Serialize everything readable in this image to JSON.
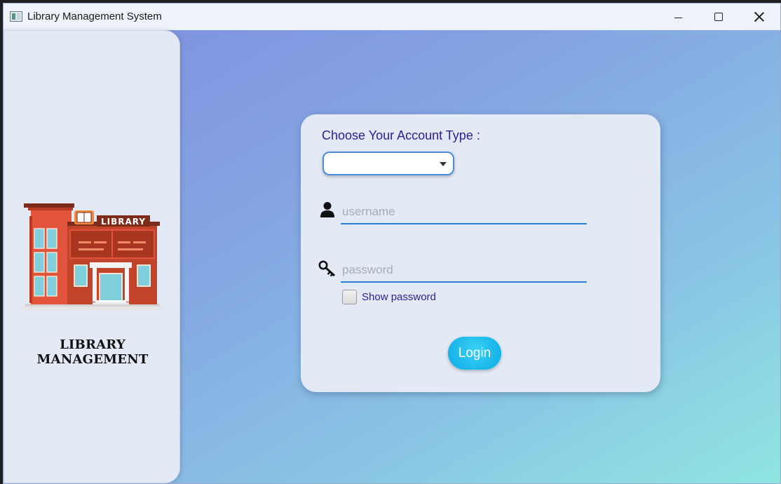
{
  "window": {
    "title": "Library Management System"
  },
  "sidebar": {
    "brand_title": "LIBRARY MANAGEMENT",
    "sign_text": "LIBRARY"
  },
  "login_form": {
    "account_type_label": "Choose Your Account Type :",
    "account_type_value": "",
    "username_placeholder": "username",
    "username_value": "",
    "password_placeholder": "password",
    "password_value": "",
    "show_password_label": "Show password",
    "show_password_checked": false,
    "login_label": "Login"
  },
  "colors": {
    "label_text": "#27219b",
    "field_underline": "#2f7fd6",
    "login_button": "#1ab6ea",
    "background_gradient_start": "#7f8ee0",
    "background_gradient_end": "#90e6e1",
    "panel_background": "#e3eaf6"
  },
  "icons": {
    "username": "user-icon",
    "password": "key-icon",
    "dropdown": "chevron-down-icon"
  }
}
